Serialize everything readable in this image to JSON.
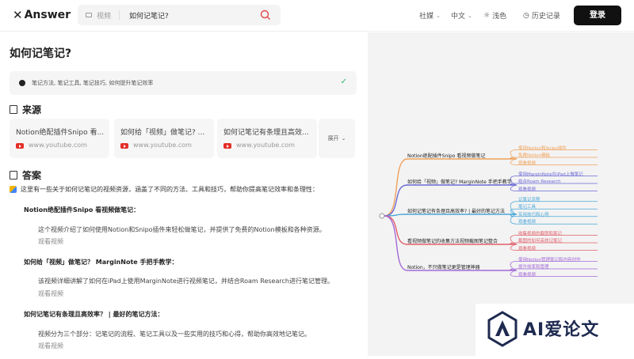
{
  "header": {
    "logo": "Answer",
    "search": {
      "source": "视频",
      "query": "如何记笔记?"
    },
    "nav": {
      "social": "社媒",
      "lang": "中文",
      "theme": "浅色",
      "history": "历史记录"
    },
    "login_label": "登录"
  },
  "main": {
    "title": "如何记笔记?",
    "keywords": "笔记方法, 笔记工具, 笔记技巧, 如何提升笔记效率",
    "sources_heading": "来源",
    "sources": [
      {
        "title": "Notion绝配插件Snipo 看...",
        "url": "www.youtube.com"
      },
      {
        "title": "如何给「视频」做笔记? ...",
        "url": "www.youtube.com"
      },
      {
        "title": "如何记笔记有条理且高效...",
        "url": "www.youtube.com"
      }
    ],
    "expand_label": "展开",
    "answer_heading": "答案",
    "intro": "这里有一些关于如何记笔记的视频资源，涵盖了不同的方法、工具和技巧，帮助你提高笔记效率和条理性：",
    "items": [
      {
        "title": "Notion绝配插件Snipo 看视频做笔记：",
        "desc": "这个视频介绍了如何使用Notion和Snipo插件来轻松做笔记，并提供了免费的Notion模板和各种资源。",
        "watch": "观看视频"
      },
      {
        "title": "如何给「视频」做笔记？ MarginNote 手把手教学：",
        "desc": "该视频详细讲解了如何在iPad上使用MarginNote进行视频笔记，并结合Roam Research进行笔记管理。",
        "watch": "观看视频"
      },
      {
        "title": "如何记笔记有条理且高效率？ | 最好的笔记方法：",
        "desc": "视频分为三个部分：记笔记的流程、笔记工具以及一些实用的技巧和心得，帮助你高效地记笔记。",
        "watch": "观看视频"
      }
    ]
  },
  "mindmap": {
    "branches": [
      {
        "label": "Notion绝配插件Snipo 看视频做笔记",
        "color": "#f0a15a",
        "leaves": [
          "使用Notion和Snipo插件",
          "免费Notion模板",
          "观看视频"
        ]
      },
      {
        "label": "如何给「视频」做笔记? MarginNote 手把手教学",
        "color": "#6d6ad6",
        "leaves": [
          "使用MarginNote在iPad上做笔记",
          "结合Roam Research",
          "观看视频"
        ]
      },
      {
        "label": "如何记笔记有条理且高效率? | 最好的笔记方法",
        "color": "#4aa8d8",
        "leaves": [
          "记笔记流程",
          "笔记工具",
          "实用技巧和心得",
          "观看视频"
        ]
      },
      {
        "label": "看视频做笔记的收集方法视频截图笔记整合",
        "color": "#e0606a",
        "leaves": [
          "收集视频的截图和笔记",
          "截图的如何高效记笔记",
          "观看视频"
        ]
      },
      {
        "label": "Notion，不只做笔记更是管理神器",
        "color": "#a36ad6",
        "leaves": [
          "使用Notion管理笔记和内容创作",
          "提升效率和管理",
          "观看视频"
        ]
      }
    ]
  },
  "watermark": "AI爱论文"
}
